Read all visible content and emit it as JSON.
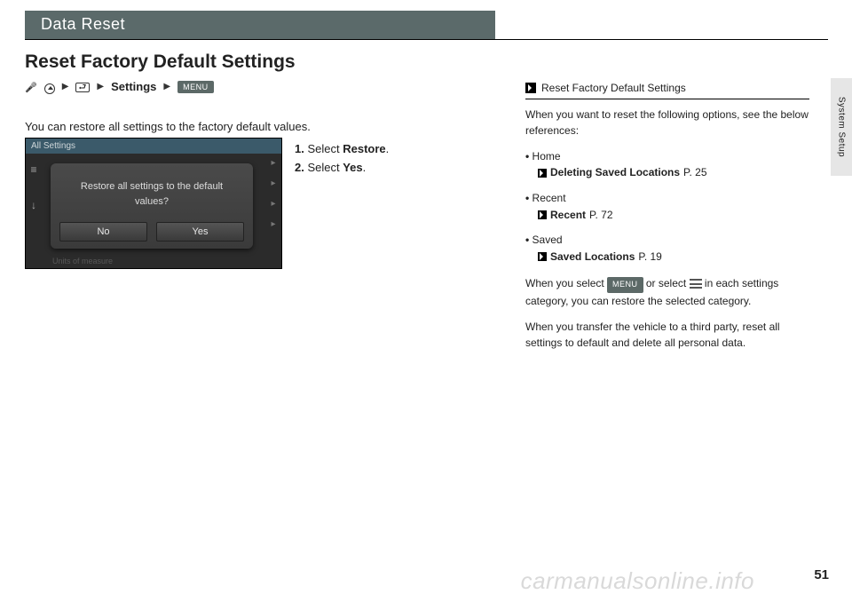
{
  "chapter": "Data Reset",
  "section_title": "Reset Factory Default Settings",
  "nav": {
    "settings_label": "Settings",
    "menu_chip": "MENU"
  },
  "intro": "You can restore all settings to the factory default values.",
  "device": {
    "header": "All Settings",
    "dialog_line1": "Restore all settings to the default",
    "dialog_line2": "values?",
    "btn_no": "No",
    "btn_yes": "Yes",
    "footer": "Units of measure"
  },
  "steps": {
    "s1_num": "1.",
    "s1_pre": "Select ",
    "s1_bold": "Restore",
    "s1_post": ".",
    "s2_num": "2.",
    "s2_pre": "Select ",
    "s2_bold": "Yes",
    "s2_post": "."
  },
  "info": {
    "heading": "Reset Factory Default Settings",
    "lead": "When you want to reset the following options, see the below references:",
    "items": [
      {
        "label": "Home",
        "ref": "Deleting Saved Locations",
        "page": "P. 25"
      },
      {
        "label": "Recent",
        "ref": "Recent",
        "page": "P. 72"
      },
      {
        "label": "Saved",
        "ref": "Saved Locations",
        "page": "P. 19"
      }
    ],
    "para2a": "When you select ",
    "para2_menu": "MENU",
    "para2b": " or select ",
    "para2c": " in each settings category, you can restore the selected category.",
    "para3": "When you transfer the vehicle to a third party, reset all settings to default and delete all personal data."
  },
  "sidetab": "System Setup",
  "page_number": "51",
  "watermark": "carmanualsonline.info"
}
